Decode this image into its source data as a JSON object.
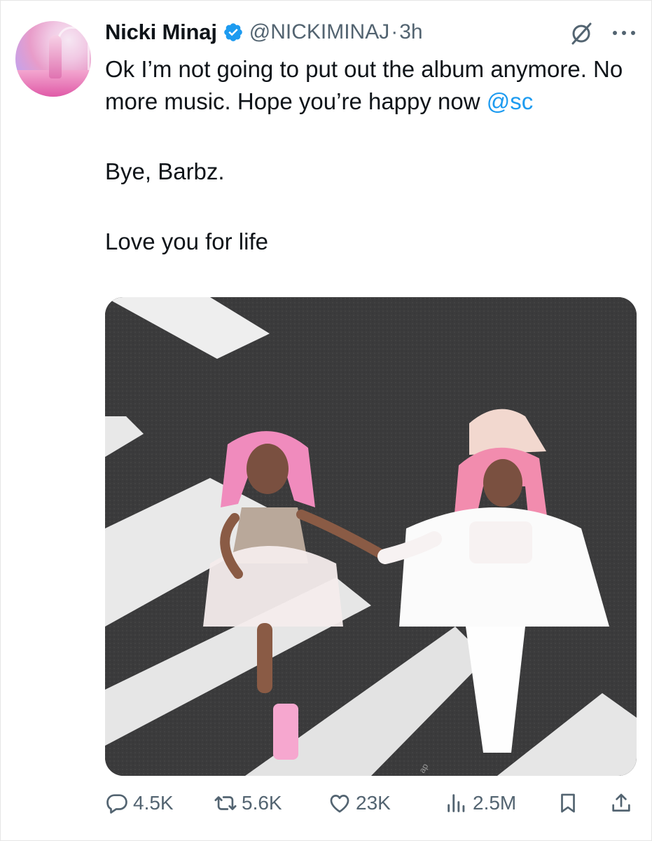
{
  "tweet": {
    "author_name": "Nicki Minaj",
    "handle": "@NICKIMINAJ",
    "separator": "·",
    "time_ago": "3h",
    "text_line1": "Ok I’m not going to put out the album anymore. No more music. Hope you’re happy now ",
    "mention": "@sc",
    "text_line2": "Bye, Barbz.",
    "text_line3": "Love you for life",
    "media_watermark": "ap"
  },
  "icons": {
    "verified": "verified-badge-icon",
    "grok": "grok-icon",
    "more": "more-icon",
    "reply": "reply-icon",
    "retweet": "retweet-icon",
    "like": "like-icon",
    "views": "views-icon",
    "bookmark": "bookmark-icon",
    "share": "share-icon"
  },
  "stats": {
    "replies": "4.5K",
    "retweets": "5.6K",
    "likes": "23K",
    "views": "2.5M"
  },
  "colors": {
    "verified_blue": "#1d9bf0",
    "text": "#0f1419",
    "muted": "#536471"
  }
}
